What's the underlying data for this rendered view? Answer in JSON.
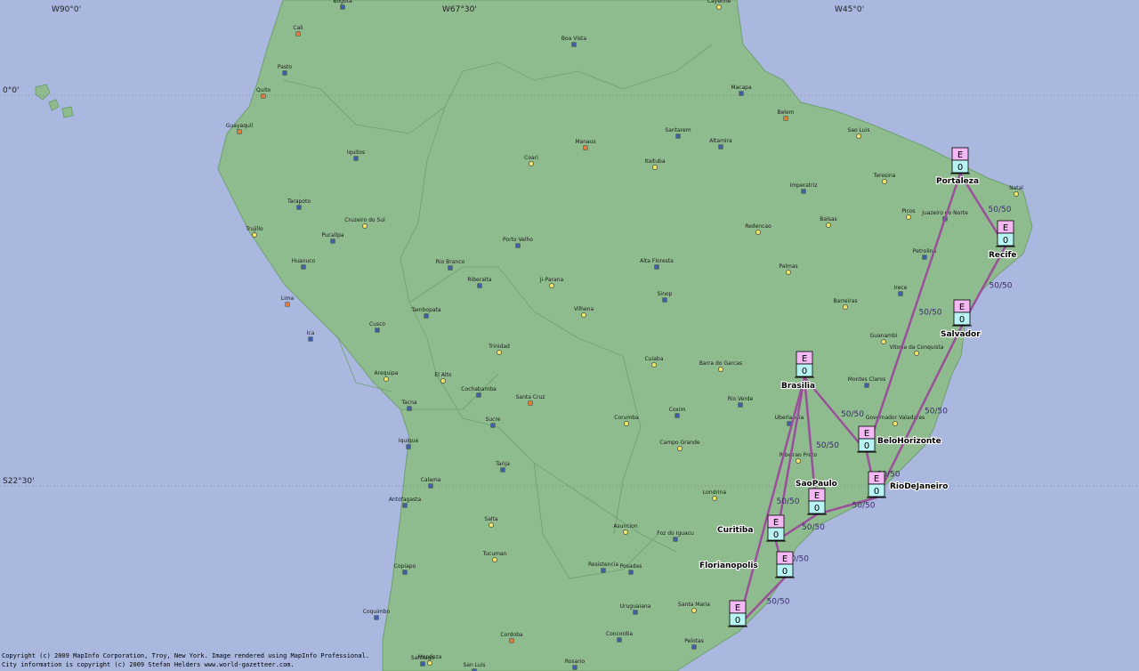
{
  "coordinates": {
    "lon_labels": [
      "W90°0'",
      "W67°30'",
      "W45°0'"
    ],
    "lat_labels": [
      "0°0'",
      "S22°30'"
    ]
  },
  "colors": {
    "ocean": "#aab8e0",
    "land": "#8fbc8f",
    "link": "#9b4f9b",
    "node_top": "#f4b8f4",
    "node_bottom": "#b8f4f4"
  },
  "cities": [
    "Bogota",
    "Cali",
    "Boa Vista",
    "Cayenne",
    "Pasto",
    "Quito",
    "Macapa",
    "Belem",
    "Sao Luis",
    "Guayaquil",
    "Manaus",
    "Santarem",
    "Altamira",
    "Coari",
    "Itaituba",
    "Iquitos",
    "Teresina",
    "Imperatriz",
    "Natal",
    "Tarapoto",
    "Cruzeiro do Sul",
    "Picos",
    "Juazeiro do Norte",
    "Trujillo",
    "Pucallpa",
    "Porto Velho",
    "Redencao",
    "Balsas",
    "Rio Branco",
    "Alta Floresta",
    "Petrolina",
    "Huanuco",
    "Palmas",
    "Riberalta",
    "Ji-Parana",
    "Sinop",
    "Barreiras",
    "Irece",
    "Lima",
    "Tambopata",
    "Vilhena",
    "Cusco",
    "Guanambi",
    "Ica",
    "Vitoria da Conquista",
    "Trinidad",
    "Cuiaba",
    "Barra do Garcas",
    "Arequipa",
    "El Alto",
    "Montes Claros",
    "Cochabamba",
    "Santa Cruz",
    "Rio Verde",
    "Tacna",
    "Sucre",
    "Coxim",
    "Uberlandia",
    "Governador Valadares",
    "Iquique",
    "Corumba",
    "Campo Grande",
    "Ribeirao Preto",
    "Tarija",
    "Calama",
    "Londrina",
    "Antofagasta",
    "Salta",
    "Asuncion",
    "Foz do Iguacu",
    "Tucuman",
    "Resistencia",
    "Posadas",
    "Copiapo",
    "Uruguaiana",
    "Santa Maria",
    "Coquimbo",
    "Cordoba",
    "Concordia",
    "Pelotas",
    "Santiago",
    "Mendoza",
    "San Luis",
    "Rosario"
  ],
  "nodes": [
    {
      "id": "fortaleza",
      "label": "Portaleza",
      "top": "E",
      "bottom": "0"
    },
    {
      "id": "recife",
      "label": "Recife",
      "top": "E",
      "bottom": "0"
    },
    {
      "id": "salvador",
      "label": "Salvador",
      "top": "E",
      "bottom": "0"
    },
    {
      "id": "brasilia",
      "label": "Brasilia",
      "top": "E",
      "bottom": "0"
    },
    {
      "id": "belohorizonte",
      "label": "BeloHorizonte",
      "top": "E",
      "bottom": "0"
    },
    {
      "id": "riodejaneiro",
      "label": "RioDeJaneiro",
      "top": "E",
      "bottom": "0"
    },
    {
      "id": "saopaulo",
      "label": "SaoPaulo",
      "top": "E",
      "bottom": "0"
    },
    {
      "id": "curitiba",
      "label": "Curitiba",
      "top": "E",
      "bottom": "0"
    },
    {
      "id": "florianopolis",
      "label": "Florianopolis",
      "top": "E",
      "bottom": "0"
    },
    {
      "id": "portoalegre",
      "label": "",
      "top": "E",
      "bottom": "0"
    }
  ],
  "links": [
    {
      "from": "fortaleza",
      "to": "recife",
      "label": "50/50"
    },
    {
      "from": "fortaleza",
      "to": "belohorizonte",
      "label": "50/50"
    },
    {
      "from": "recife",
      "to": "salvador",
      "label": "50/50"
    },
    {
      "from": "salvador",
      "to": "riodejaneiro",
      "label": "50/50"
    },
    {
      "from": "brasilia",
      "to": "belohorizonte",
      "label": "50/50"
    },
    {
      "from": "brasilia",
      "to": "saopaulo",
      "label": "50/50"
    },
    {
      "from": "belohorizonte",
      "to": "riodejaneiro",
      "label": "50/50"
    },
    {
      "from": "brasilia",
      "to": "curitiba",
      "label": ""
    },
    {
      "from": "riodejaneiro",
      "to": "saopaulo",
      "label": "50/50"
    },
    {
      "from": "saopaulo",
      "to": "curitiba",
      "label": "50/50"
    },
    {
      "from": "curitiba",
      "to": "florianopolis",
      "label": "50/50"
    },
    {
      "from": "florianopolis",
      "to": "portoalegre",
      "label": "50/50"
    },
    {
      "from": "brasilia",
      "to": "portoalegre",
      "label": "50/50"
    }
  ],
  "copyright": [
    "Copyright (c) 2009 MapInfo Corporation, Troy, New York. Image rendered using MapInfo Professional.",
    "City information is copyright (c) 2009 Stefan Helders www.world-gazetteer.com."
  ]
}
